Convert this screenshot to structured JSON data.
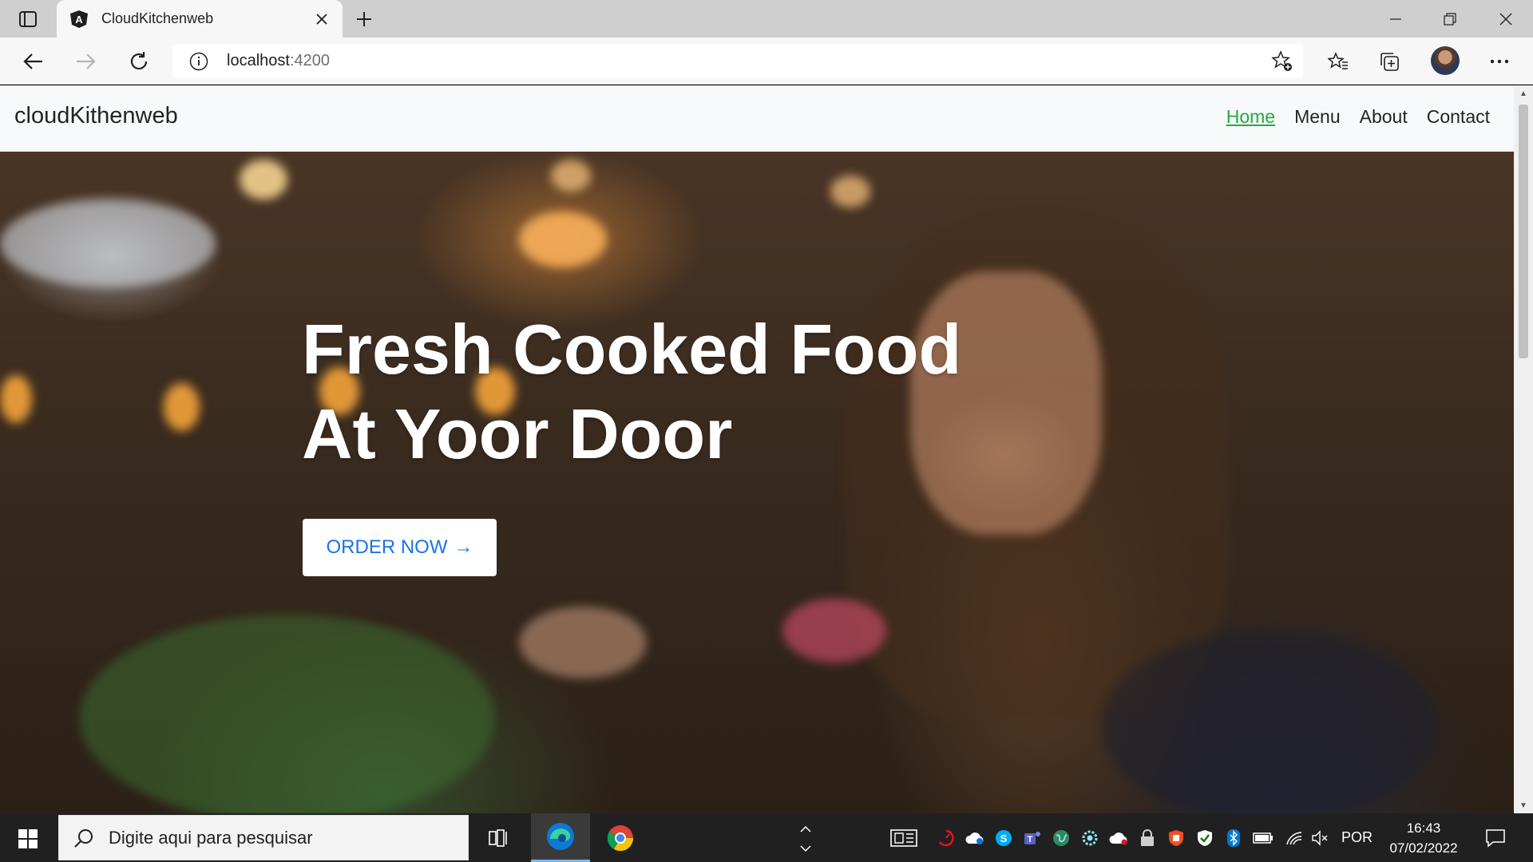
{
  "browser": {
    "tab_title": "CloudKitchenweb",
    "url_host": "localhost",
    "url_port": ":4200"
  },
  "navbar": {
    "brand": "cloudKithenweb",
    "links": [
      {
        "label": "Home",
        "active": true
      },
      {
        "label": "Menu",
        "active": false
      },
      {
        "label": "About",
        "active": false
      },
      {
        "label": "Contact",
        "active": false
      }
    ]
  },
  "hero": {
    "title_line1": "Fresh Cooked Food",
    "title_line2": "At Yoor Door",
    "cta_label": "ORDER NOW",
    "cta_arrow": "→"
  },
  "taskbar": {
    "search_placeholder": "Digite aqui para pesquisar",
    "language": "POR",
    "time": "16:43",
    "date": "07/02/2022"
  },
  "colors": {
    "active_link": "#28a745",
    "cta_text": "#1a73e8",
    "navbar_bg": "#f8f9fa"
  }
}
